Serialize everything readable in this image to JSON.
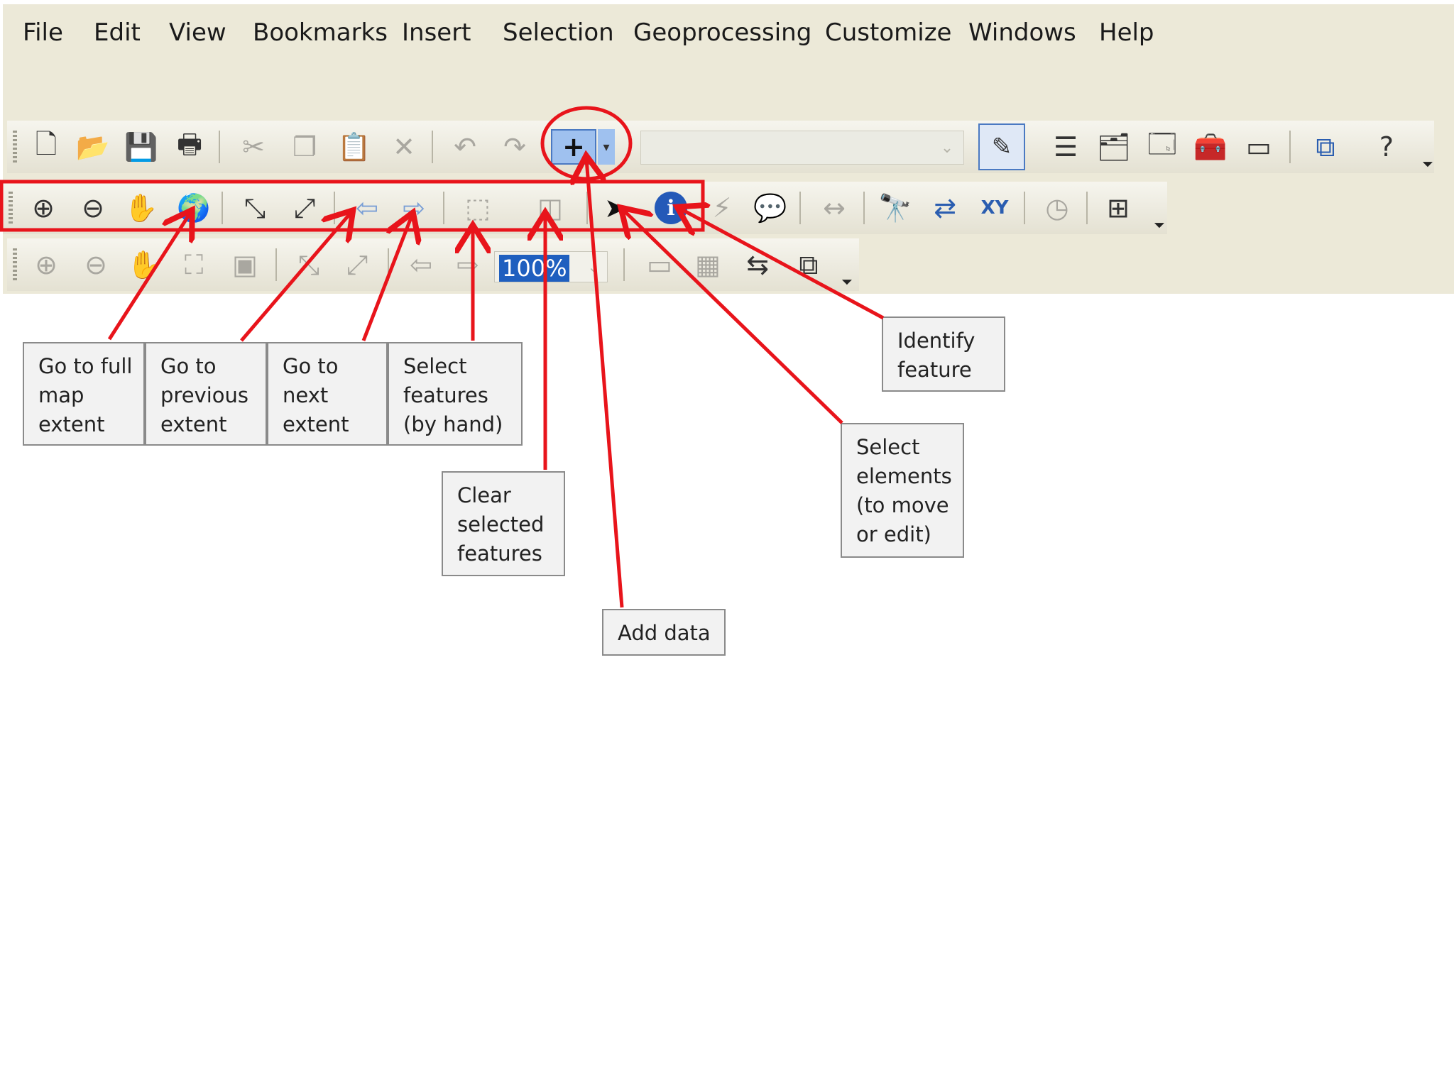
{
  "menubar": {
    "items": [
      "File",
      "Edit",
      "View",
      "Bookmarks",
      "Insert",
      "Selection",
      "Geoprocessing",
      "Customize",
      "Windows",
      "Help"
    ]
  },
  "standard_toolbar": {
    "buttons": [
      {
        "icon": "new-document-icon",
        "glyph": "🗋"
      },
      {
        "icon": "open-folder-icon",
        "glyph": "📂"
      },
      {
        "icon": "save-icon",
        "glyph": "💾"
      },
      {
        "icon": "print-icon",
        "glyph": "🖶"
      },
      {
        "icon": "cut-icon",
        "glyph": "✂"
      },
      {
        "icon": "copy-icon",
        "glyph": "❐"
      },
      {
        "icon": "paste-icon",
        "glyph": "📋"
      },
      {
        "icon": "delete-icon",
        "glyph": "✕"
      },
      {
        "icon": "undo-icon",
        "glyph": "↶"
      },
      {
        "icon": "redo-icon",
        "glyph": "↷"
      }
    ],
    "add_data_glyph": "+",
    "combo_arrow": "⌄",
    "right_buttons": [
      {
        "icon": "table-of-contents-icon",
        "glyph": "☰"
      },
      {
        "icon": "catalog-icon",
        "glyph": "🗂"
      },
      {
        "icon": "search-window-icon",
        "glyph": "🗔"
      },
      {
        "icon": "arctoolbox-icon",
        "glyph": "🧰"
      },
      {
        "icon": "python-window-icon",
        "glyph": "▭"
      },
      {
        "icon": "modelbuilder-icon",
        "glyph": "⧉"
      },
      {
        "icon": "whats-this-help-icon",
        "glyph": "?"
      }
    ],
    "overflow_glyph": "⏷"
  },
  "tools_toolbar": {
    "buttons": [
      {
        "icon": "zoom-in-icon",
        "glyph": "⊕"
      },
      {
        "icon": "zoom-out-icon",
        "glyph": "⊖"
      },
      {
        "icon": "pan-hand-icon",
        "glyph": "✋"
      },
      {
        "icon": "full-extent-globe-icon",
        "glyph": "🌍"
      },
      {
        "icon": "fixed-zoom-in-icon",
        "glyph": "⤡"
      },
      {
        "icon": "fixed-zoom-out-icon",
        "glyph": "⤢"
      },
      {
        "icon": "previous-extent-icon",
        "glyph": "⇦"
      },
      {
        "icon": "next-extent-icon",
        "glyph": "⇨"
      },
      {
        "icon": "select-features-icon",
        "glyph": "⬚"
      },
      {
        "icon": "clear-selection-icon",
        "glyph": "◫"
      },
      {
        "icon": "select-elements-arrow-icon",
        "glyph": "➤"
      },
      {
        "icon": "identify-icon",
        "glyph": "ℹ"
      },
      {
        "icon": "hyperlink-icon",
        "glyph": "⚡"
      },
      {
        "icon": "html-popup-icon",
        "glyph": "💬"
      },
      {
        "icon": "measure-icon",
        "glyph": "↔"
      },
      {
        "icon": "find-binoculars-icon",
        "glyph": "🔭"
      },
      {
        "icon": "find-route-icon",
        "glyph": "⇄"
      },
      {
        "icon": "go-to-xy-icon",
        "glyph": "XY"
      },
      {
        "icon": "time-slider-icon",
        "glyph": "◷"
      },
      {
        "icon": "create-viewer-window-icon",
        "glyph": "⊞"
      }
    ],
    "overflow_glyph": "⏷"
  },
  "layout_toolbar": {
    "buttons": [
      {
        "icon": "layout-zoom-in-icon",
        "glyph": "⊕"
      },
      {
        "icon": "layout-zoom-out-icon",
        "glyph": "⊖"
      },
      {
        "icon": "layout-pan-icon",
        "glyph": "✋"
      },
      {
        "icon": "zoom-whole-page-icon",
        "glyph": "⛶"
      },
      {
        "icon": "zoom-100-percent-icon",
        "glyph": "▣"
      },
      {
        "icon": "layout-fixed-zoom-in-icon",
        "glyph": "⤡"
      },
      {
        "icon": "layout-fixed-zoom-out-icon",
        "glyph": "⤢"
      },
      {
        "icon": "layout-previous-extent-icon",
        "glyph": "⇦"
      },
      {
        "icon": "layout-next-extent-icon",
        "glyph": "⇨"
      }
    ],
    "zoom_value": "100%",
    "zoom_arrow": "⌄",
    "right_buttons": [
      {
        "icon": "toggle-draft-mode-icon",
        "glyph": "▭"
      },
      {
        "icon": "focus-data-frame-icon",
        "glyph": "▦"
      },
      {
        "icon": "change-layout-icon",
        "glyph": "⇆"
      },
      {
        "icon": "data-driven-pages-icon",
        "glyph": "⧉"
      }
    ],
    "overflow_glyph": "⏷"
  },
  "callouts": {
    "full_extent": "Go to full\nmap\nextent",
    "previous_extent": "Go to\nprevious\nextent",
    "next_extent": "Go to\nnext\nextent",
    "select_by_hand": "Select\nfeatures\n(by hand)",
    "clear_selected": "Clear\nselected\nfeatures",
    "add_data": "Add data",
    "select_elements": "Select\nelements\n(to move\nor edit)",
    "identify": "Identify\nfeature"
  },
  "colors": {
    "annotation_red": "#e8141b",
    "toolbar_bg": "#ece9d8",
    "callout_bg": "#f2f2f2",
    "callout_border": "#8a8a8a"
  }
}
